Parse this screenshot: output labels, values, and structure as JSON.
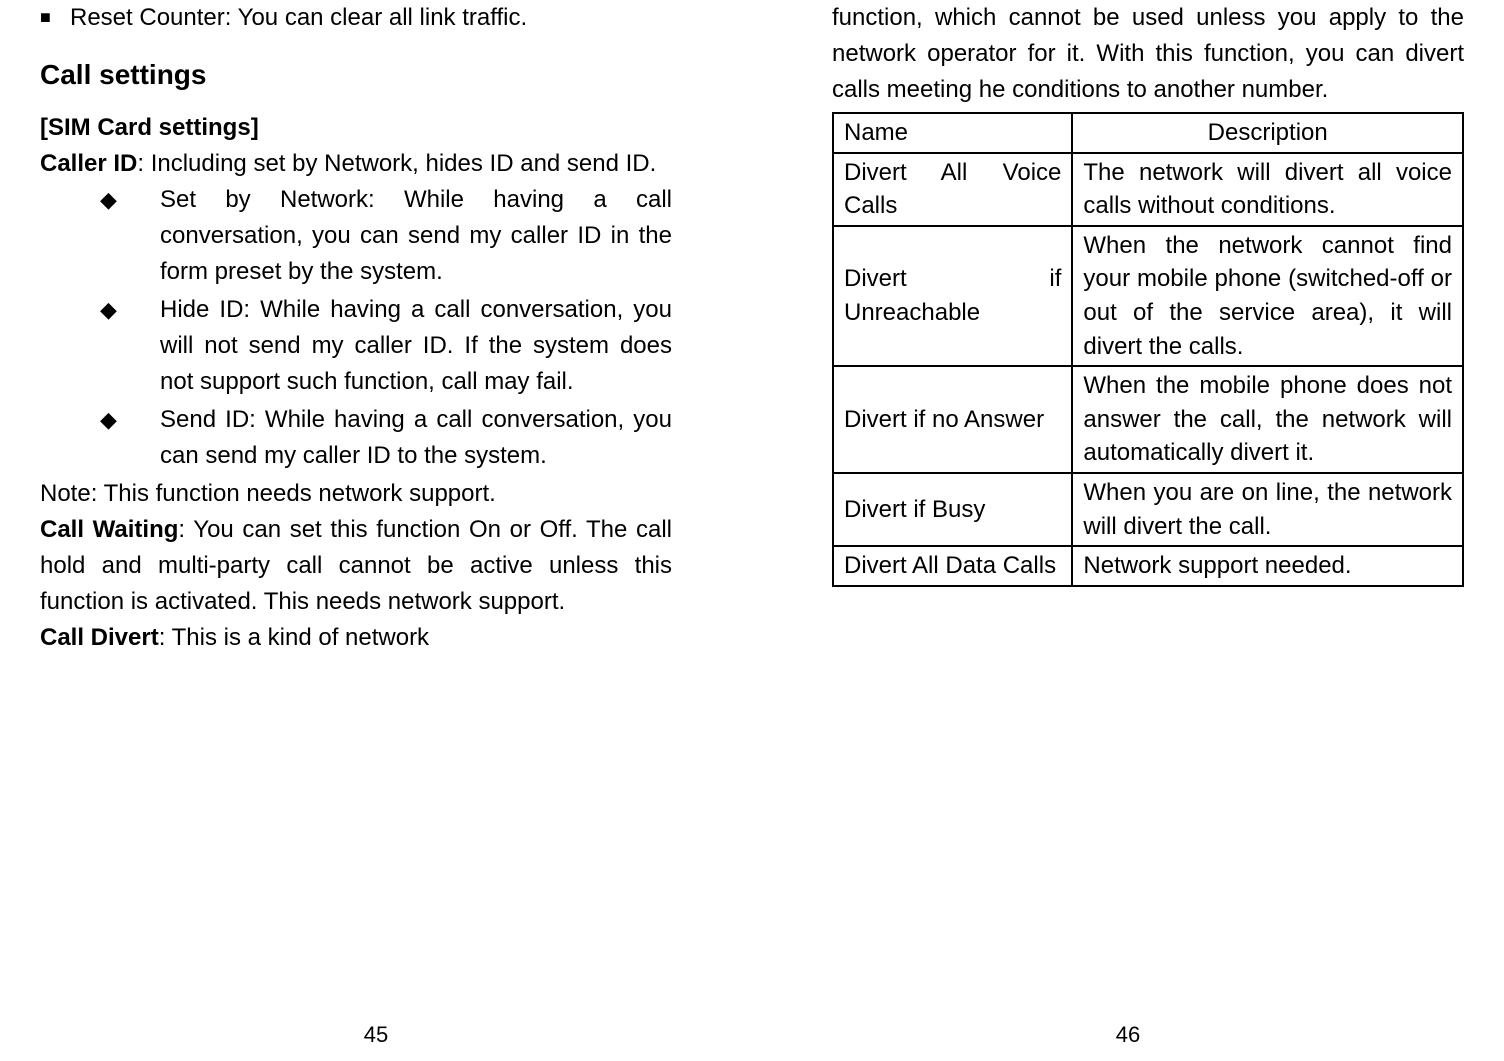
{
  "left": {
    "resetCounter": "Reset Counter: You can clear all link traffic.",
    "heading": "Call settings",
    "simHeading": "[SIM Card settings]",
    "callerIdLabel": "Caller ID",
    "callerIdText": ": Including set by Network, hides ID and send ID.",
    "bullets": [
      "Set by Network: While having a call conversation, you can send my caller ID in the form preset by the system.",
      "Hide ID: While having a call conversation, you will not send my caller ID. If the system does not support such function, call may fail.",
      "Send ID: While having a call conversation, you can send my caller ID to the system."
    ],
    "note": "Note: This function needs network support.",
    "callWaitingLabel": "Call Waiting",
    "callWaitingText": ": You can set this function On or Off. The call hold and multi-party call cannot be active unless this function is activated. This needs network support.",
    "callDivertLabel": "Call Divert",
    "callDivertText": ": This is a kind of network",
    "pageNum": "45"
  },
  "right": {
    "intro": "function, which cannot be used unless you apply to the network operator for it. With this function, you can divert calls meeting he conditions to another number.",
    "table": {
      "header": {
        "name": "Name",
        "desc": "Description"
      },
      "rows": [
        {
          "name": "Divert All Voice Calls",
          "desc": "The network will divert all voice calls without conditions."
        },
        {
          "name": "Divert if Unreachable",
          "desc": "When the network cannot find your mobile phone (switched-off or out of the service area), it will divert the calls."
        },
        {
          "name": "Divert if no Answer",
          "desc": "When the mobile phone does not answer the call, the network will automatically divert it."
        },
        {
          "name": "Divert if Busy",
          "desc": "When you are on line, the network will divert the call."
        },
        {
          "name": "Divert All Data Calls",
          "desc": "Network support needed."
        }
      ]
    },
    "pageNum": "46"
  }
}
